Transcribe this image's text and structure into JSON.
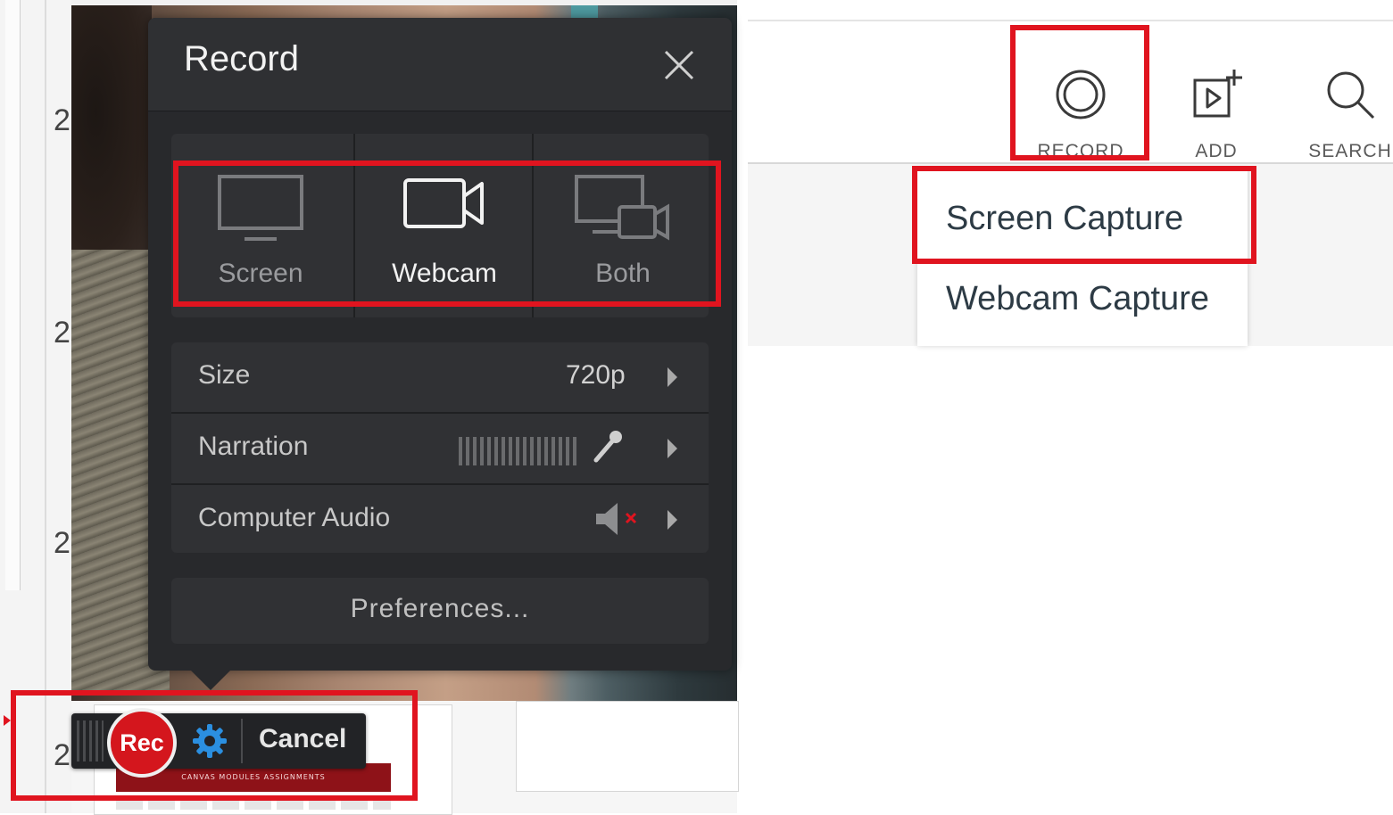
{
  "left_background": {
    "row_numbers": [
      "2",
      "2",
      "2",
      "2"
    ],
    "banner_text": "CANVAS MODULES ASSIGNMENTS"
  },
  "record_panel": {
    "title": "Record",
    "close_icon": "close-icon",
    "modes": [
      {
        "label": "Screen",
        "icon": "monitor-icon",
        "selected": false
      },
      {
        "label": "Webcam",
        "icon": "webcam-icon",
        "selected": true
      },
      {
        "label": "Both",
        "icon": "monitor-webcam-icon",
        "selected": false
      }
    ],
    "settings": {
      "size": {
        "label": "Size",
        "value": "720p"
      },
      "narration": {
        "label": "Narration",
        "icon": "microphone-icon"
      },
      "computer_audio": {
        "label": "Computer Audio",
        "icon": "speaker-muted-icon"
      }
    },
    "preferences_label": "Preferences..."
  },
  "recording_toolbar": {
    "rec_label": "Rec",
    "settings_icon": "gear-icon",
    "cancel_label": "Cancel"
  },
  "web_toolbar": {
    "buttons": [
      {
        "label": "RECORD",
        "icon": "record-icon"
      },
      {
        "label": "ADD",
        "icon": "add-media-icon"
      },
      {
        "label": "SEARCH",
        "icon": "search-icon"
      }
    ],
    "dropdown_items": [
      "Screen Capture",
      "Webcam Capture"
    ]
  },
  "colors": {
    "highlight": "#e0141f",
    "panel_bg": "#28292c",
    "rec_red": "#d4161d",
    "gear_blue": "#2b8fe0"
  }
}
